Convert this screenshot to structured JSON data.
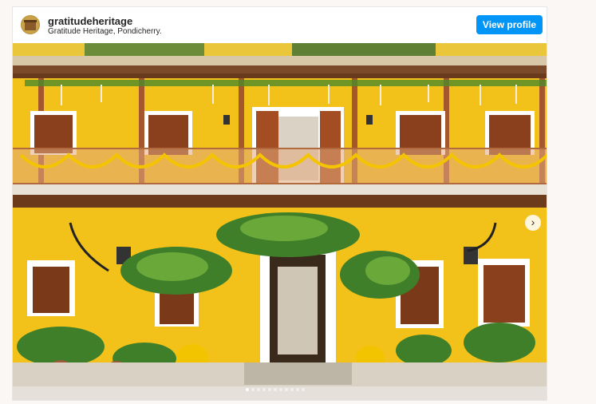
{
  "post": {
    "username": "gratitudeheritage",
    "location": "Gratitude Heritage, Pondicherry.",
    "view_profile_label": "View profile",
    "image_alt_icon": "photo-of-yellow-heritage-house"
  },
  "carousel": {
    "next_icon": "chevron-right-icon",
    "next_glyph": "›",
    "dot_count": 11,
    "active_index": 0
  },
  "colors": {
    "wall": "#f2c21b",
    "accent_button": "#0095f6",
    "wood": "#9a4e2a"
  }
}
